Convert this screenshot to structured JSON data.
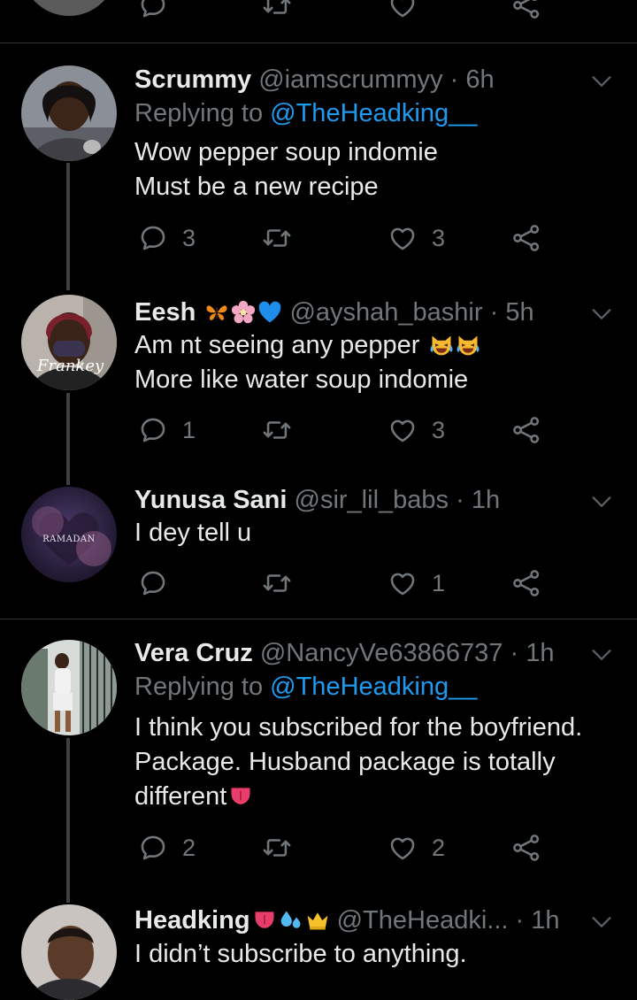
{
  "colors": {
    "background": "#000000",
    "text": "#e7e9ea",
    "muted": "#71767b",
    "link": "#1d9bf0",
    "divider": "#2f3336"
  },
  "top_partial": {
    "reply_count": "",
    "retweet_count": "",
    "like_count": ""
  },
  "tweets": [
    {
      "name": "Scrummy",
      "handle": "@iamscrummyy",
      "dot": "·",
      "time": "6h",
      "replying_prefix": "Replying to ",
      "replying_mention": "@TheHeadking__",
      "lines": [
        "Wow pepper soup indomie",
        "Must be a new recipe"
      ],
      "reply_count": "3",
      "retweet_count": "",
      "like_count": "3",
      "avatar_icon": "avatar-woman-icon"
    },
    {
      "name": "Eesh",
      "name_emojis": [
        "butterfly-icon",
        "blossom-icon",
        "blue-heart-icon"
      ],
      "handle": "@ayshah_bashir",
      "dot": "·",
      "time": "5h",
      "lines": [
        "Am nt seeing any pepper",
        "More like water soup indomie"
      ],
      "line_emojis": [
        "cat-tears-of-joy-icon",
        "cat-tears-of-joy-icon"
      ],
      "reply_count": "1",
      "retweet_count": "",
      "like_count": "3",
      "avatar_signature": "Frankey"
    },
    {
      "name": "Yunusa Sani",
      "handle": "@sir_lil_babs",
      "dot": "·",
      "time": "1h",
      "lines": [
        "I dey tell u"
      ],
      "reply_count": "",
      "retweet_count": "",
      "like_count": "1",
      "avatar_text": "RAMADAN"
    },
    {
      "name": "Vera Cruz",
      "handle": "@NancyVe63866737",
      "dot": "·",
      "time": "1h",
      "replying_prefix": "Replying to ",
      "replying_mention": "@TheHeadking__",
      "lines": [
        "I think you subscribed for the boyfriend.",
        "Package. Husband package is totally",
        "different"
      ],
      "line_emojis": [
        "tongue-icon"
      ],
      "reply_count": "2",
      "retweet_count": "",
      "like_count": "2"
    },
    {
      "name": "Headking",
      "name_emojis": [
        "tongue-icon",
        "droplets-icon",
        "crown-icon"
      ],
      "handle": "@TheHeadki...",
      "dot": "·",
      "time": "1h",
      "lines": [
        "I didn’t subscribe to anything."
      ]
    }
  ]
}
